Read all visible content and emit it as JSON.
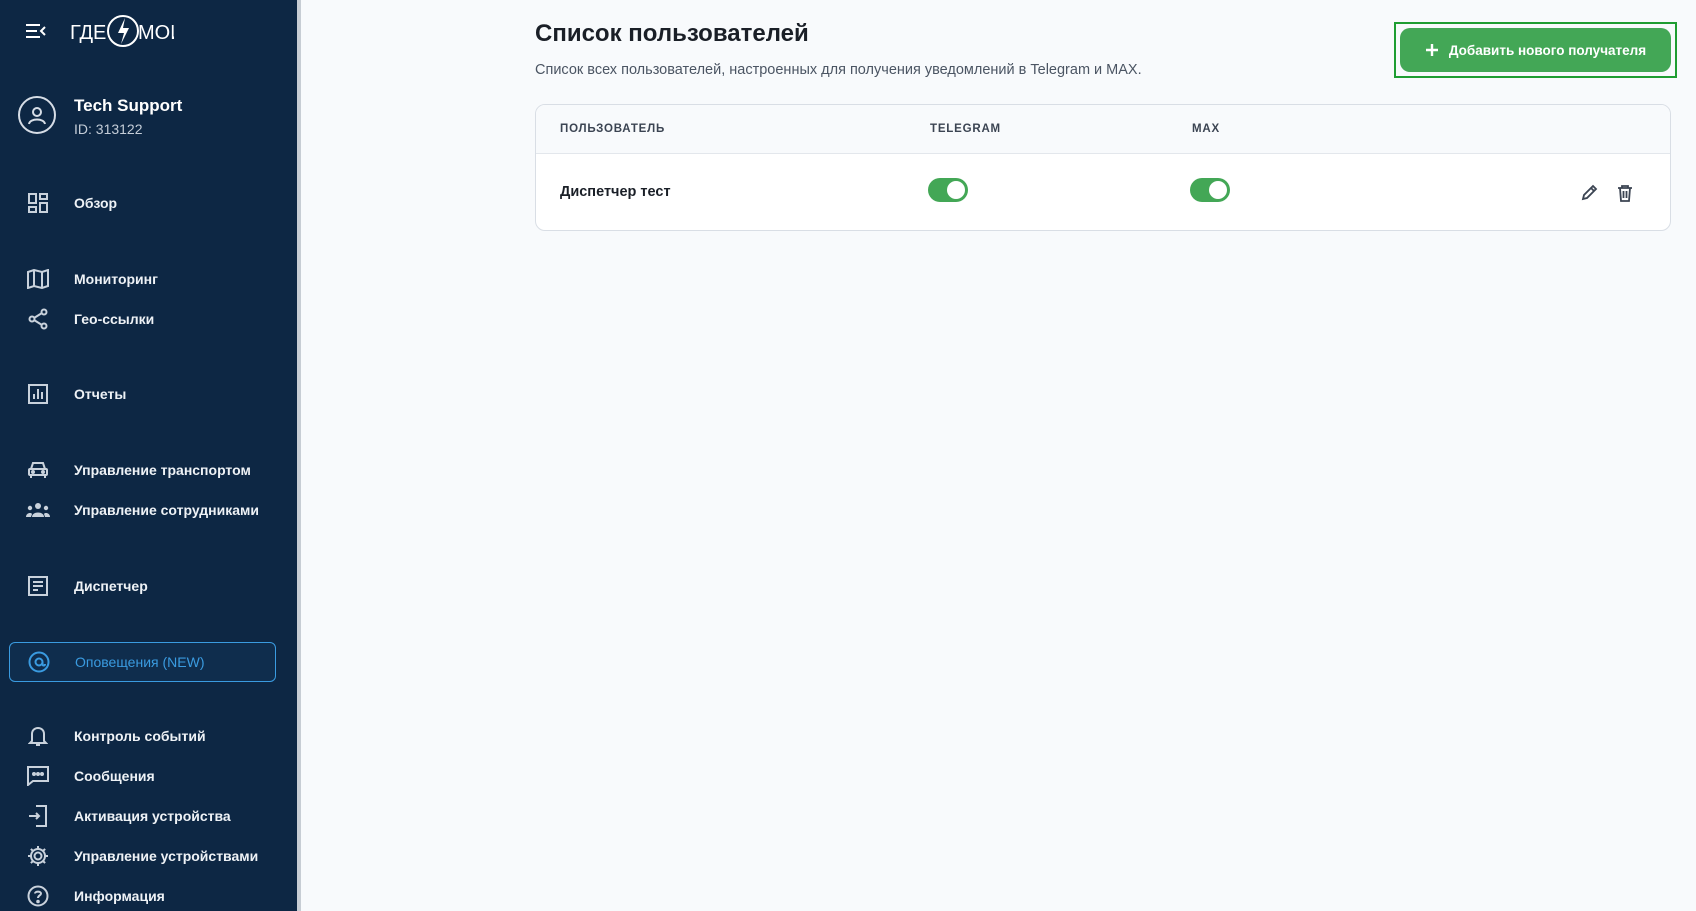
{
  "brand": {
    "logo_text_left": "ГДЕ",
    "logo_text_right": "МОИ",
    "accent": "#43a756",
    "sidebar_bg": "#0d2744",
    "active_color": "#3a9be0"
  },
  "profile": {
    "name": "Tech Support",
    "id_text": "ID: 313122"
  },
  "sidebar": {
    "items": [
      {
        "label": "Обзор",
        "icon": "dashboard-icon"
      },
      {
        "label": "Мониторинг",
        "icon": "map-icon"
      },
      {
        "label": "Гео-ссылки",
        "icon": "share-icon"
      },
      {
        "label": "Отчеты",
        "icon": "chart-icon"
      },
      {
        "label": "Управление транспортом",
        "icon": "car-icon"
      },
      {
        "label": "Управление сотрудниками",
        "icon": "people-icon"
      },
      {
        "label": "Диспетчер",
        "icon": "document-icon"
      },
      {
        "label": "Оповещения (NEW)",
        "icon": "at-sign-icon",
        "active": true
      },
      {
        "label": "Контроль событий",
        "icon": "bell-icon"
      },
      {
        "label": "Сообщения",
        "icon": "chat-icon"
      },
      {
        "label": "Активация устройства",
        "icon": "login-icon"
      },
      {
        "label": "Управление устройствами",
        "icon": "gear-icon"
      },
      {
        "label": "Информация",
        "icon": "help-icon"
      }
    ]
  },
  "main": {
    "title": "Список пользователей",
    "subtitle": "Список всех пользователей, настроенных для получения уведомлений в Telegram и MAX.",
    "add_button_label": "Добавить нового получателя",
    "table": {
      "columns": [
        "ПОЛЬЗОВАТЕЛЬ",
        "TELEGRAM",
        "MAX"
      ],
      "rows": [
        {
          "user": "Диспетчер тест",
          "telegram": true,
          "max": true
        }
      ]
    }
  }
}
